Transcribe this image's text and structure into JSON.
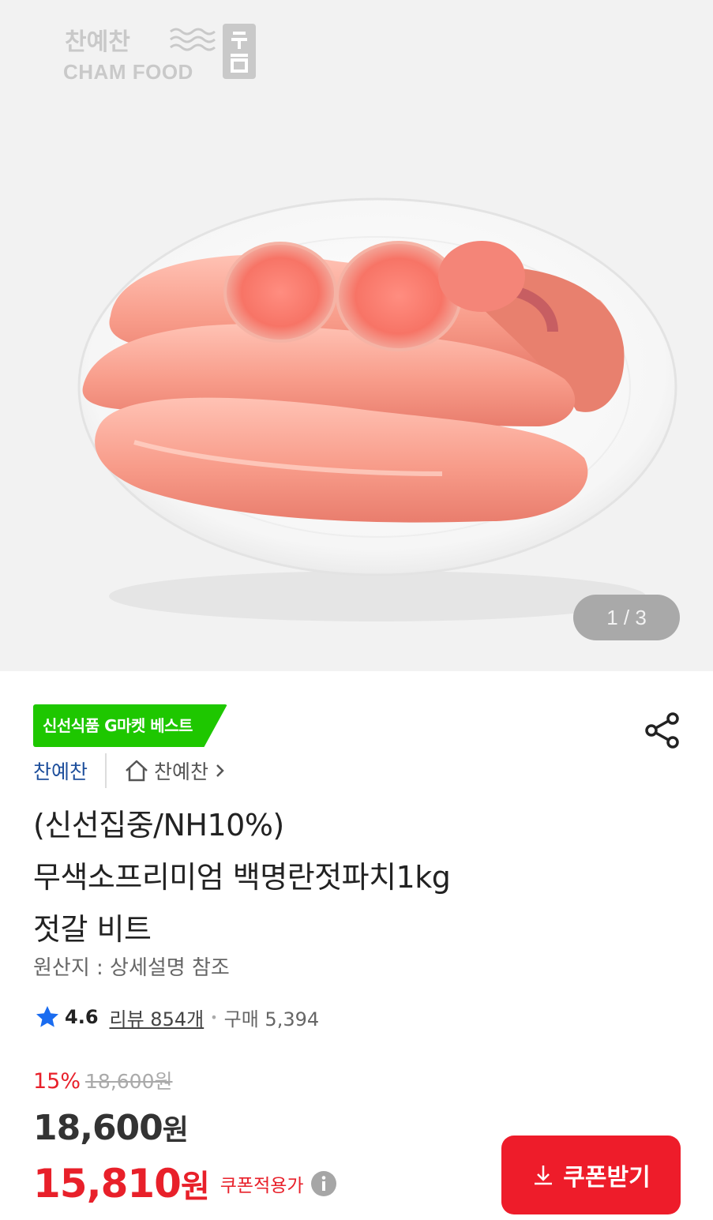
{
  "hero": {
    "brand_kr": "찬예찬",
    "brand_en": "CHAM FOOD",
    "pager": "1 / 3"
  },
  "badge": "신선식품 G마켓 베스트",
  "seller": {
    "name": "찬예찬",
    "store": "찬예찬"
  },
  "product": {
    "title_lines": [
      "(신선집중/NH10%)",
      "무색소프리미엄 백명란젓파치1kg",
      "젓갈 비트"
    ],
    "origin": "원산지 : 상세설명 참조"
  },
  "rating": {
    "score": "4.6",
    "reviews": "리뷰 854개",
    "purchases": "구매 5,394"
  },
  "price": {
    "discount_rate": "15%",
    "original": "18,600원",
    "sale_amount": "18,600",
    "sale_unit": "원",
    "coupon_amount": "15,810",
    "coupon_unit": "원",
    "coupon_note": "쿠폰적용가"
  },
  "coupon_button": "쿠폰받기",
  "colors": {
    "accent_red": "#ee1c2a",
    "badge_green": "#1ec700",
    "seller_blue": "#1e4f9c",
    "star_blue": "#1a6cf0"
  },
  "icons": [
    "share-icon",
    "home-icon",
    "chevron-right-icon",
    "star-icon",
    "info-icon",
    "download-icon"
  ]
}
